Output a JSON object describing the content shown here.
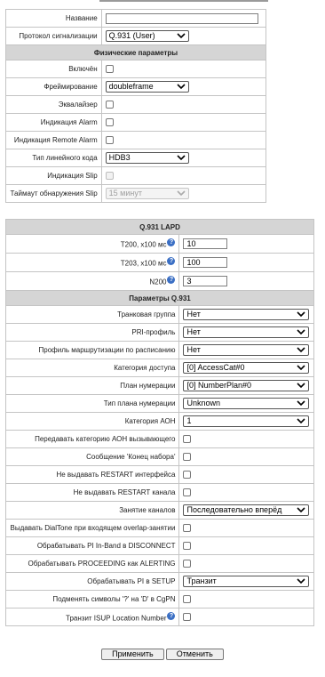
{
  "general": {
    "name_label": "Название",
    "name_value": "",
    "protocol_label": "Протокол сигнализации",
    "protocol_value": "Q.931 (User)"
  },
  "physical": {
    "title": "Физические параметры",
    "enabled_label": "Включён",
    "framing_label": "Фреймирование",
    "framing_value": "doubleframe",
    "equalizer_label": "Эквалайзер",
    "alarm_label": "Индикация Alarm",
    "remote_alarm_label": "Индикация Remote Alarm",
    "line_code_label": "Тип линейного кода",
    "line_code_value": "HDB3",
    "slip_label": "Индикация Slip",
    "slip_timeout_label": "Таймаут обнаружения Slip",
    "slip_timeout_value": "15 минут"
  },
  "lapd": {
    "title": "Q.931 LAPD",
    "t200_label": "T200, x100 мс",
    "t200_value": "10",
    "t203_label": "T203, x100 мс",
    "t203_value": "100",
    "n200_label": "N200",
    "n200_value": "3"
  },
  "q931": {
    "title": "Параметры Q.931",
    "trunk_group_label": "Транковая группа",
    "trunk_group_value": "Нет",
    "pri_profile_label": "PRI-профиль",
    "pri_profile_value": "Нет",
    "schedule_routing_label": "Профиль маршрутизации по расписанию",
    "schedule_routing_value": "Нет",
    "access_category_label": "Категория доступа",
    "access_category_value": "[0] AccessCat#0",
    "numbering_plan_label": "План нумерации",
    "numbering_plan_value": "[0] NumberPlan#0",
    "plan_type_label": "Тип плана нумерации",
    "plan_type_value": "Unknown",
    "aon_category_label": "Категория АОН",
    "aon_category_value": "1",
    "pass_aon_category_label": "Передавать категорию АОН вызывающего",
    "sending_complete_label": "Сообщение 'Конец набора'",
    "no_restart_interface_label": "Не выдавать RESTART интерфейса",
    "no_restart_channel_label": "Не выдавать RESTART канала",
    "channel_seizure_label": "Занятие каналов",
    "channel_seizure_value": "Последовательно вперёд",
    "dialtone_overlap_label": "Выдавать DialTone при входящем overlap-занятии",
    "pi_inband_disconnect_label": "Обрабатывать PI In-Band в DISCONNECT",
    "proceeding_alerting_label": "Обрабатывать PROCEEDING как ALERTING",
    "pi_setup_label": "Обрабатывать PI в SETUP",
    "pi_setup_value": "Транзит",
    "replace_symbols_label": "Подменять символы '?' на 'D' в CgPN",
    "isup_location_label": "Транзит ISUP Location Number"
  },
  "buttons": {
    "apply": "Применить",
    "cancel": "Отменить"
  },
  "icons": {
    "help": "question-circle-icon",
    "select_arrow": "chevron-down-icon"
  },
  "colors": {
    "section_header": "#d5d5d5",
    "help_icon": "#3b6fc4",
    "border": "#c4c4c4"
  }
}
